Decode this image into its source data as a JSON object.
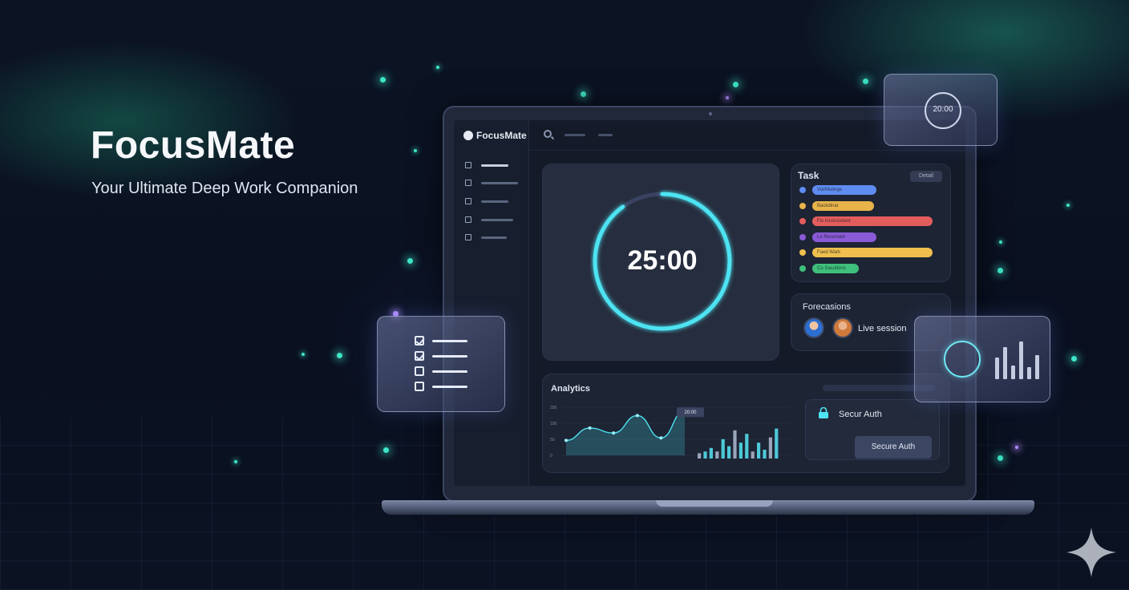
{
  "hero": {
    "title": "FocusMate",
    "subtitle": "Your Ultimate Deep Work Companion"
  },
  "app": {
    "brand": "FocusMate",
    "timer": {
      "display": "25:00",
      "progress": 0.9
    },
    "tasks": {
      "title": "Task",
      "action_label": "Detail",
      "items": [
        {
          "label": "Vol/Mulinge",
          "color": "#5f8cf0",
          "fill": 0.5
        },
        {
          "label": "Backdinat",
          "color": "#e8b44a",
          "fill": 0.48
        },
        {
          "label": "Fix Inconsistent",
          "color": "#e35d5d",
          "fill": 0.94
        },
        {
          "label": "Ln Resoniam",
          "color": "#8a5ad6",
          "fill": 0.5
        },
        {
          "label": "Faed Wark",
          "color": "#eebf4d",
          "fill": 0.94
        },
        {
          "label": "Cu Sacutions",
          "color": "#3fbf7a",
          "fill": 0.36
        }
      ]
    },
    "session": {
      "title": "Forecasions",
      "label": "Live session"
    },
    "analytics": {
      "title": "Analytics",
      "tooltip": "20:00",
      "y_ticks": [
        "200",
        "100",
        "50",
        "0"
      ],
      "line_values": [
        0.3,
        0.55,
        0.45,
        0.8,
        0.35,
        0.9
      ],
      "bar_values": [
        0.15,
        0.2,
        0.3,
        0.2,
        0.55,
        0.35,
        0.8,
        0.45,
        0.7,
        0.2,
        0.45,
        0.25,
        0.6,
        0.85
      ]
    },
    "auth": {
      "label": "Secur Auth",
      "button": "Secure Auth"
    }
  },
  "floating": {
    "timer_text": "20:00",
    "checklist": [
      true,
      true,
      false,
      false
    ],
    "stats_bars": [
      0.55,
      0.8,
      0.35,
      0.95,
      0.3,
      0.6
    ]
  },
  "colors": {
    "accent": "#4de3f2",
    "ring_track": "#2b3247",
    "background": "#0b1120"
  },
  "icons": [
    "brand-icon",
    "search-icon",
    "lock-icon",
    "sparkle-icon",
    "checkbox-icon"
  ]
}
